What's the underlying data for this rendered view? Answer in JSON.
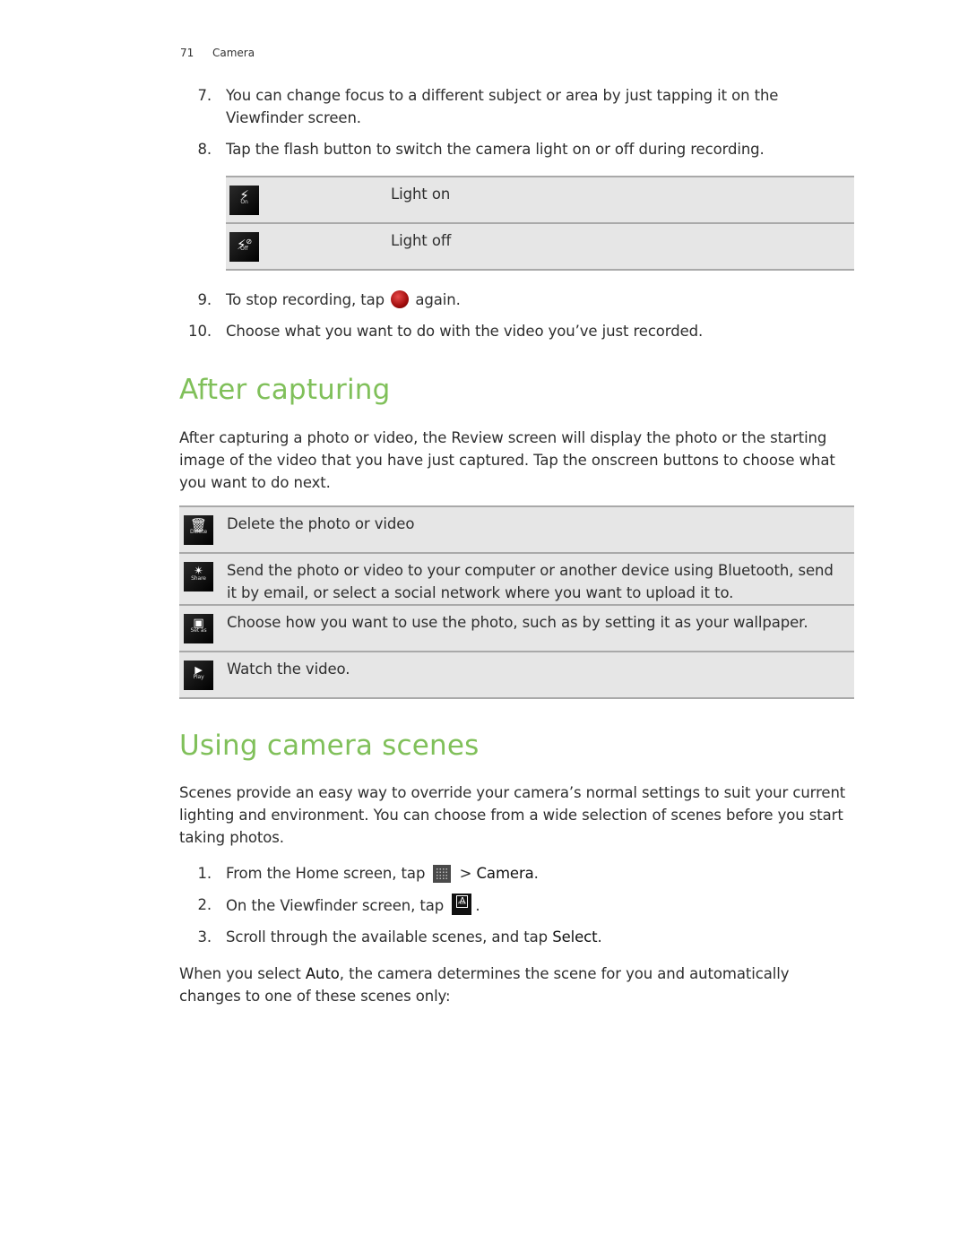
{
  "header": {
    "page_number": "71",
    "chapter": "Camera"
  },
  "steps_top": [
    {
      "num": "7.",
      "text": "You can change focus to a different subject or area by just tapping it on the Viewfinder screen."
    },
    {
      "num": "8.",
      "text": "Tap the flash button to switch the camera light on or off during recording."
    }
  ],
  "flash_table": [
    {
      "icon": "flash-on-icon",
      "caption": "On",
      "label": "Light on"
    },
    {
      "icon": "flash-off-icon",
      "caption": "Off",
      "label": "Light off"
    }
  ],
  "steps_mid": [
    {
      "num": "9.",
      "text_before": "To stop recording, tap",
      "icon": "record-button-icon",
      "text_after": "again."
    },
    {
      "num": "10.",
      "text": "Choose what you want to do with the video you’ve just recorded."
    }
  ],
  "after_capturing": {
    "heading": "After capturing",
    "intro": "After capturing a photo or video, the Review screen will display the photo or the starting image of the video that you have just captured. Tap the onscreen buttons to choose what you want to do next.",
    "actions": [
      {
        "icon": "delete-icon",
        "caption": "Delete",
        "text": "Delete the photo or video"
      },
      {
        "icon": "share-icon",
        "caption": "Share",
        "text": "Send the photo or video to your computer or another device using Bluetooth, send it by email, or select a social network where you want to upload it to."
      },
      {
        "icon": "set-as-icon",
        "caption": "Set as",
        "text": "Choose how you want to use the photo, such as by setting it as your wallpaper."
      },
      {
        "icon": "play-icon",
        "caption": "Play",
        "text": "Watch the video."
      }
    ]
  },
  "camera_scenes": {
    "heading": "Using camera scenes",
    "intro": "Scenes provide an easy way to override your camera’s normal settings to suit your current lighting and environment. You can choose from a wide selection of scenes before you start taking photos.",
    "steps": [
      {
        "num": "1.",
        "text_before": "From the Home screen, tap",
        "icon": "all-apps-icon",
        "text_mid": " > ",
        "ui_term": "Camera",
        "text_after": "."
      },
      {
        "num": "2.",
        "text_before": "On the Viewfinder screen, tap",
        "icon": "auto-scene-icon",
        "icon_caption": "Auto",
        "text_after": "."
      },
      {
        "num": "3.",
        "text_before": "Scroll through the available scenes, and tap ",
        "ui_term": "Select",
        "text_after": "."
      }
    ],
    "outro_before": "When you select ",
    "outro_term": "Auto",
    "outro_after": ", the camera determines the scene for you and automatically changes to one of these scenes only:"
  }
}
